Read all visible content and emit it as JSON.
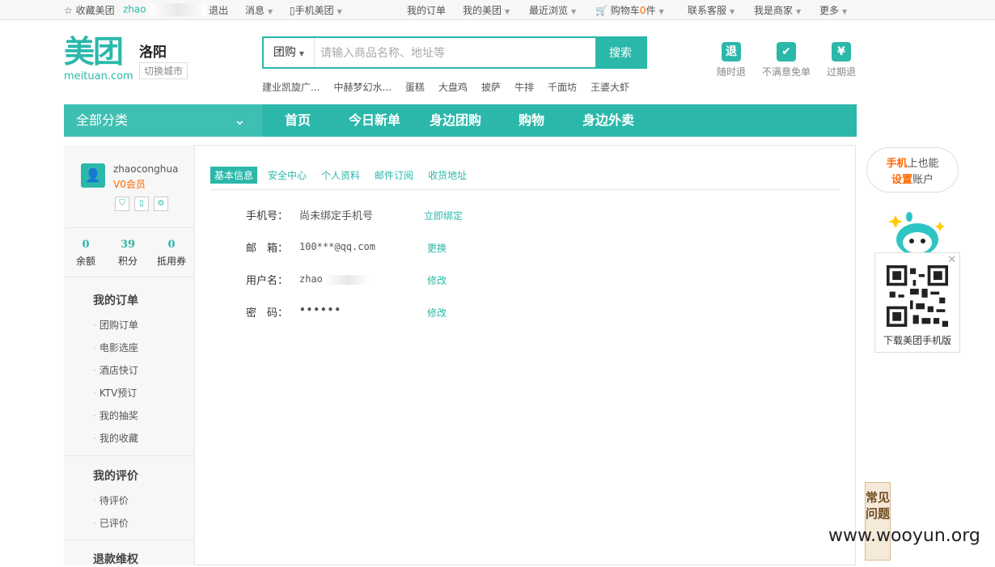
{
  "topbar": {
    "favorite": "收藏美团",
    "user_prefix": "zhao",
    "logout": "退出",
    "messages": "消息",
    "mobile": "手机美团",
    "my_orders": "我的订单",
    "my_meituan": "我的美团",
    "recent": "最近浏览",
    "cart_label": "购物车",
    "cart_count": "0",
    "cart_unit": "件",
    "service": "联系客服",
    "merchant": "我是商家",
    "more": "更多"
  },
  "header": {
    "logo": "美团",
    "logo_sub": "meituan.com",
    "city": "洛阳",
    "switch_city": "切换城市",
    "search_type": "团购",
    "search_placeholder": "请输入商品名称、地址等",
    "search_button": "搜索",
    "hot_keywords": [
      "建业凯旋广...",
      "中赫梦幻水...",
      "蛋糕",
      "大盘鸡",
      "披萨",
      "牛排",
      "千面坊",
      "王婆大虾"
    ],
    "guarantees": [
      {
        "icon": "退",
        "label": "随时退"
      },
      {
        "icon": "✔",
        "label": "不满意免单"
      },
      {
        "icon": "¥",
        "label": "过期退"
      }
    ]
  },
  "nav": {
    "all_categories": "全部分类",
    "items": [
      "首页",
      "今日新单",
      "身边团购",
      "购物",
      "身边外卖"
    ]
  },
  "sidebar": {
    "username": "zhaoconghua",
    "level": "V0会员",
    "stats": [
      {
        "value": "0",
        "label": "余额"
      },
      {
        "value": "39",
        "label": "积分"
      },
      {
        "value": "0",
        "label": "抵用券"
      }
    ],
    "sections": [
      {
        "title": "我的订单",
        "items": [
          "团购订单",
          "电影选座",
          "酒店快订",
          "KTV预订",
          "我的抽奖",
          "我的收藏"
        ]
      },
      {
        "title": "我的评价",
        "items": [
          "待评价",
          "已评价"
        ]
      },
      {
        "title": "退款维权",
        "items": []
      }
    ]
  },
  "content": {
    "tabs": [
      "基本信息",
      "安全中心",
      "个人资料",
      "邮件订阅",
      "收货地址"
    ],
    "rows": [
      {
        "label": "手机号：",
        "value": "尚未绑定手机号",
        "action": "立即绑定"
      },
      {
        "label": "邮　箱：",
        "value": "100***@qq.com",
        "action": "更换"
      },
      {
        "label": "用户名：",
        "value": "zhao",
        "action": "修改"
      },
      {
        "label": "密　码：",
        "value": "••••••",
        "action": "修改"
      }
    ]
  },
  "float": {
    "bubble_hl1": "手机",
    "bubble_t1": "上也能",
    "bubble_hl2": "设置",
    "bubble_t2": "账户",
    "qr_label": "下载美团手机版",
    "faq": "常见问题"
  },
  "watermark": "www.wooyun.org",
  "colors": {
    "brand": "#2bb8aa",
    "accent": "#ff6600"
  }
}
